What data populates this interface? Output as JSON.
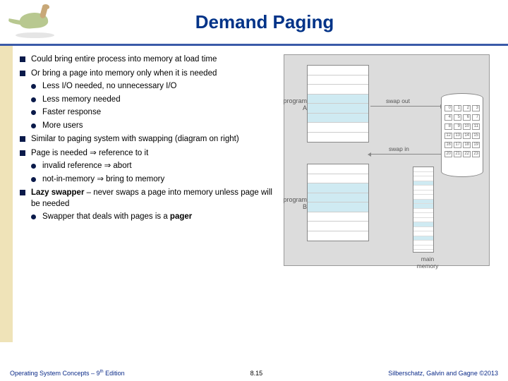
{
  "header": {
    "title": "Demand Paging"
  },
  "bullets": {
    "b1": "Could bring entire process into memory at load time",
    "b2": "Or bring a page into memory only when it is needed",
    "b2s": {
      "s1": "Less I/O needed, no unnecessary I/O",
      "s2": "Less memory needed",
      "s3": "Faster response",
      "s4": "More users"
    },
    "b3": "Similar to paging system with swapping (diagram on right)",
    "b4": "Page is needed ⇒ reference to it",
    "b4s": {
      "s1": "invalid reference ⇒ abort",
      "s2": "not-in-memory ⇒ bring to memory"
    },
    "b5a": "Lazy swapper",
    "b5b": " – never swaps a page into memory unless page will be needed",
    "b5s": {
      "s1a": "Swapper that deals with pages is a ",
      "s1b": "pager"
    }
  },
  "diagram": {
    "progA": "program\nA",
    "progB": "program\nB",
    "swapOut": "swap out",
    "swapIn": "swap in",
    "mainMem": "main\nmemory",
    "cells": [
      "0",
      "1",
      "2",
      "3",
      "4",
      "5",
      "6",
      "7",
      "8",
      "9",
      "10",
      "11",
      "12",
      "13",
      "14",
      "15",
      "16",
      "17",
      "18",
      "19",
      "20",
      "21",
      "22",
      "23"
    ]
  },
  "footer": {
    "left": "Operating System Concepts – 9",
    "leftSup": "th",
    "leftEnd": " Edition",
    "mid": "8.15",
    "right": "Silberschatz, Galvin and Gagne ©2013"
  }
}
